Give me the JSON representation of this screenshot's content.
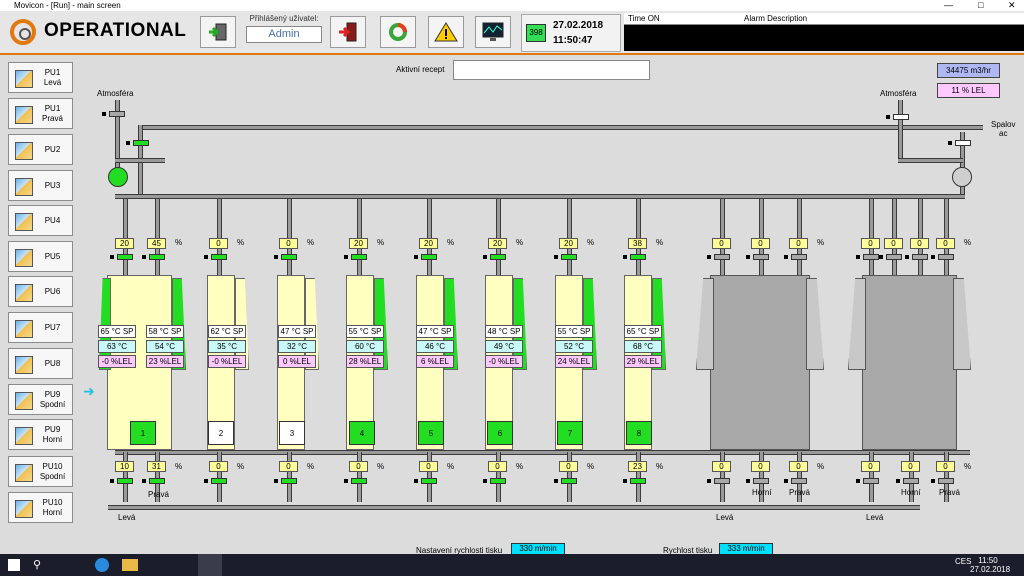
{
  "window": {
    "title": "Movicon - [Run] - main screen"
  },
  "header": {
    "app_title": "OPERATIONAL",
    "user_label": "Přihlášený uživatel:",
    "user_name": "Admin",
    "counter": "398",
    "date": "27.02.2018",
    "time": "11:50:47",
    "alarm_col_time": "Time ON",
    "alarm_col_desc": "Alarm Description"
  },
  "nav": [
    "PU1\nLevá",
    "PU1\nPravá",
    "PU2",
    "PU3",
    "PU4",
    "PU5",
    "PU6",
    "PU7",
    "PU8",
    "PU9\nSpodní",
    "PU9\nHorní",
    "PU10\nSpodní",
    "PU10\nHorní"
  ],
  "recipe": {
    "label": "Aktivní recept",
    "value": ""
  },
  "flow": {
    "value": "34475 m3/hr",
    "lel": "11 % LEL"
  },
  "labels": {
    "atm_left": "Atmosféra",
    "atm_right": "Atmosféra",
    "spalovac": "Spalov\nac",
    "pct": "%",
    "leva": "Levá",
    "prava": "Pravá",
    "horni": "Horní"
  },
  "top_values": [
    "20",
    "45",
    "0",
    "0",
    "20",
    "20",
    "20",
    "20",
    "38",
    "0",
    "0",
    "0",
    "0",
    "0",
    "0",
    "0"
  ],
  "bottom_values": [
    "10",
    "31",
    "0",
    "0",
    "0",
    "0",
    "0",
    "0",
    "23",
    "0",
    "0",
    "0",
    "0",
    "0",
    "0"
  ],
  "units": [
    {
      "sp": "65 °C SP",
      "t": "63 °C",
      "lel": "-0 %LEL",
      "num": ""
    },
    {
      "sp": "58 °C SP",
      "t": "54 °C",
      "lel": "23 %LEL",
      "num": "1"
    },
    {
      "sp": "62 °C SP",
      "t": "35 °C",
      "lel": "-0 %LEL",
      "num": "2"
    },
    {
      "sp": "47 °C SP",
      "t": "32 °C",
      "lel": "0 %LEL",
      "num": "3"
    },
    {
      "sp": "55 °C SP",
      "t": "60 °C",
      "lel": "28 %LEL",
      "num": "4"
    },
    {
      "sp": "47 °C SP",
      "t": "46 °C",
      "lel": "6 %LEL",
      "num": "5"
    },
    {
      "sp": "48 °C SP",
      "t": "49 °C",
      "lel": "-0 %LEL",
      "num": "6"
    },
    {
      "sp": "55 °C SP",
      "t": "52 °C",
      "lel": "24 %LEL",
      "num": "7"
    },
    {
      "sp": "65 °C SP",
      "t": "68 °C",
      "lel": "29 %LEL",
      "num": "8"
    }
  ],
  "speed": {
    "set_label": "Nastavení rychlosti tisku",
    "set_value": "330 m/min",
    "label": "Rychlost tisku",
    "value": "333 m/min"
  },
  "taskbar": {
    "time": "11:50",
    "date": "27.02.2018",
    "lang": "CES"
  },
  "colors": {
    "accent": "#e07a10",
    "green": "#22dd22",
    "yellow": "#ffff99"
  }
}
